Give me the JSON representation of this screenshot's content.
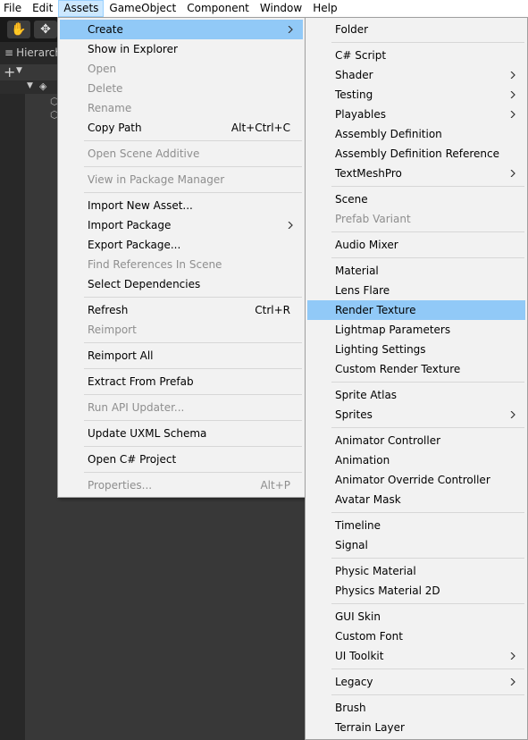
{
  "menubar": [
    "File",
    "Edit",
    "Assets",
    "GameObject",
    "Component",
    "Window",
    "Help"
  ],
  "hierarchy": {
    "tab_label": "Hierarch"
  },
  "assets_menu": {
    "items": [
      {
        "label": "Create",
        "submenu": true,
        "highlighted": true
      },
      {
        "label": "Show in Explorer"
      },
      {
        "label": "Open",
        "disabled": true
      },
      {
        "label": "Delete",
        "disabled": true
      },
      {
        "label": "Rename",
        "disabled": true
      },
      {
        "label": "Copy Path",
        "shortcut": "Alt+Ctrl+C"
      },
      {
        "label": "Open Scene Additive",
        "disabled": true
      },
      {
        "label": "View in Package Manager",
        "disabled": true
      },
      {
        "label": "Import New Asset..."
      },
      {
        "label": "Import Package",
        "submenu": true
      },
      {
        "label": "Export Package..."
      },
      {
        "label": "Find References In Scene",
        "disabled": true
      },
      {
        "label": "Select Dependencies"
      },
      {
        "label": "Refresh",
        "shortcut": "Ctrl+R"
      },
      {
        "label": "Reimport",
        "disabled": true
      },
      {
        "label": "Reimport All"
      },
      {
        "label": "Extract From Prefab"
      },
      {
        "label": "Run API Updater...",
        "disabled": true
      },
      {
        "label": "Update UXML Schema"
      },
      {
        "label": "Open C# Project"
      },
      {
        "label": "Properties...",
        "shortcut": "Alt+P",
        "disabled": true
      }
    ]
  },
  "create_menu": {
    "items": [
      {
        "label": "Folder"
      },
      {
        "label": "C# Script"
      },
      {
        "label": "Shader",
        "submenu": true
      },
      {
        "label": "Testing",
        "submenu": true
      },
      {
        "label": "Playables",
        "submenu": true
      },
      {
        "label": "Assembly Definition"
      },
      {
        "label": "Assembly Definition Reference"
      },
      {
        "label": "TextMeshPro",
        "submenu": true
      },
      {
        "label": "Scene"
      },
      {
        "label": "Prefab Variant",
        "disabled": true
      },
      {
        "label": "Audio Mixer"
      },
      {
        "label": "Material"
      },
      {
        "label": "Lens Flare"
      },
      {
        "label": "Render Texture",
        "highlighted": true
      },
      {
        "label": "Lightmap Parameters"
      },
      {
        "label": "Lighting Settings"
      },
      {
        "label": "Custom Render Texture"
      },
      {
        "label": "Sprite Atlas"
      },
      {
        "label": "Sprites",
        "submenu": true
      },
      {
        "label": "Animator Controller"
      },
      {
        "label": "Animation"
      },
      {
        "label": "Animator Override Controller"
      },
      {
        "label": "Avatar Mask"
      },
      {
        "label": "Timeline"
      },
      {
        "label": "Signal"
      },
      {
        "label": "Physic Material"
      },
      {
        "label": "Physics Material 2D"
      },
      {
        "label": "GUI Skin"
      },
      {
        "label": "Custom Font"
      },
      {
        "label": "UI Toolkit",
        "submenu": true
      },
      {
        "label": "Legacy",
        "submenu": true
      },
      {
        "label": "Brush"
      },
      {
        "label": "Terrain Layer"
      }
    ]
  },
  "colors": {
    "menu_bg": "#f2f2f2",
    "highlight": "#91c9f7",
    "disabled_text": "#8e8e8e",
    "editor_bg": "#383838"
  }
}
